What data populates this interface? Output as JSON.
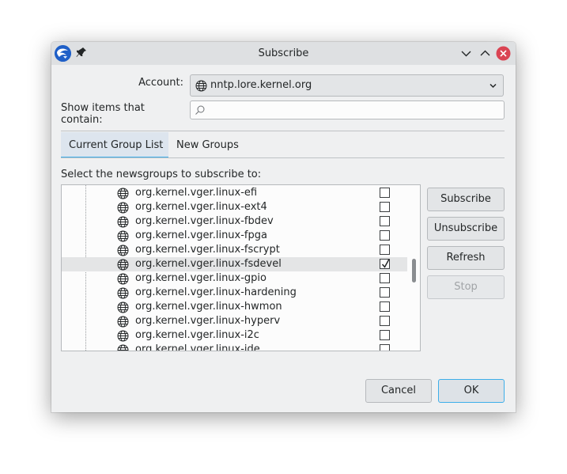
{
  "window": {
    "title": "Subscribe"
  },
  "form": {
    "account_label": "Account:",
    "account_value": "nntp.lore.kernel.org",
    "filter_label": "Show items that contain:",
    "filter_value": "",
    "filter_placeholder": ""
  },
  "tabs": [
    {
      "label": "Current Group List",
      "active": true
    },
    {
      "label": "New Groups",
      "active": false
    }
  ],
  "instructions": "Select the newsgroups to subscribe to:",
  "newsgroups": [
    {
      "name": "org.kernel.vger.linux-efi",
      "subscribed": false,
      "selected": false
    },
    {
      "name": "org.kernel.vger.linux-ext4",
      "subscribed": false,
      "selected": false
    },
    {
      "name": "org.kernel.vger.linux-fbdev",
      "subscribed": false,
      "selected": false
    },
    {
      "name": "org.kernel.vger.linux-fpga",
      "subscribed": false,
      "selected": false
    },
    {
      "name": "org.kernel.vger.linux-fscrypt",
      "subscribed": false,
      "selected": false
    },
    {
      "name": "org.kernel.vger.linux-fsdevel",
      "subscribed": true,
      "selected": true
    },
    {
      "name": "org.kernel.vger.linux-gpio",
      "subscribed": false,
      "selected": false
    },
    {
      "name": "org.kernel.vger.linux-hardening",
      "subscribed": false,
      "selected": false
    },
    {
      "name": "org.kernel.vger.linux-hwmon",
      "subscribed": false,
      "selected": false
    },
    {
      "name": "org.kernel.vger.linux-hyperv",
      "subscribed": false,
      "selected": false
    },
    {
      "name": "org.kernel.vger.linux-i2c",
      "subscribed": false,
      "selected": false
    },
    {
      "name": "org.kernel.vger.linux-ide",
      "subscribed": false,
      "selected": false
    }
  ],
  "side_buttons": {
    "subscribe": "Subscribe",
    "unsubscribe": "Unsubscribe",
    "refresh": "Refresh",
    "stop": "Stop"
  },
  "footer": {
    "cancel": "Cancel",
    "ok": "OK"
  },
  "colors": {
    "accent": "#3daee9",
    "close_button": "#da4453",
    "selected_row": "#e4e5e6"
  }
}
